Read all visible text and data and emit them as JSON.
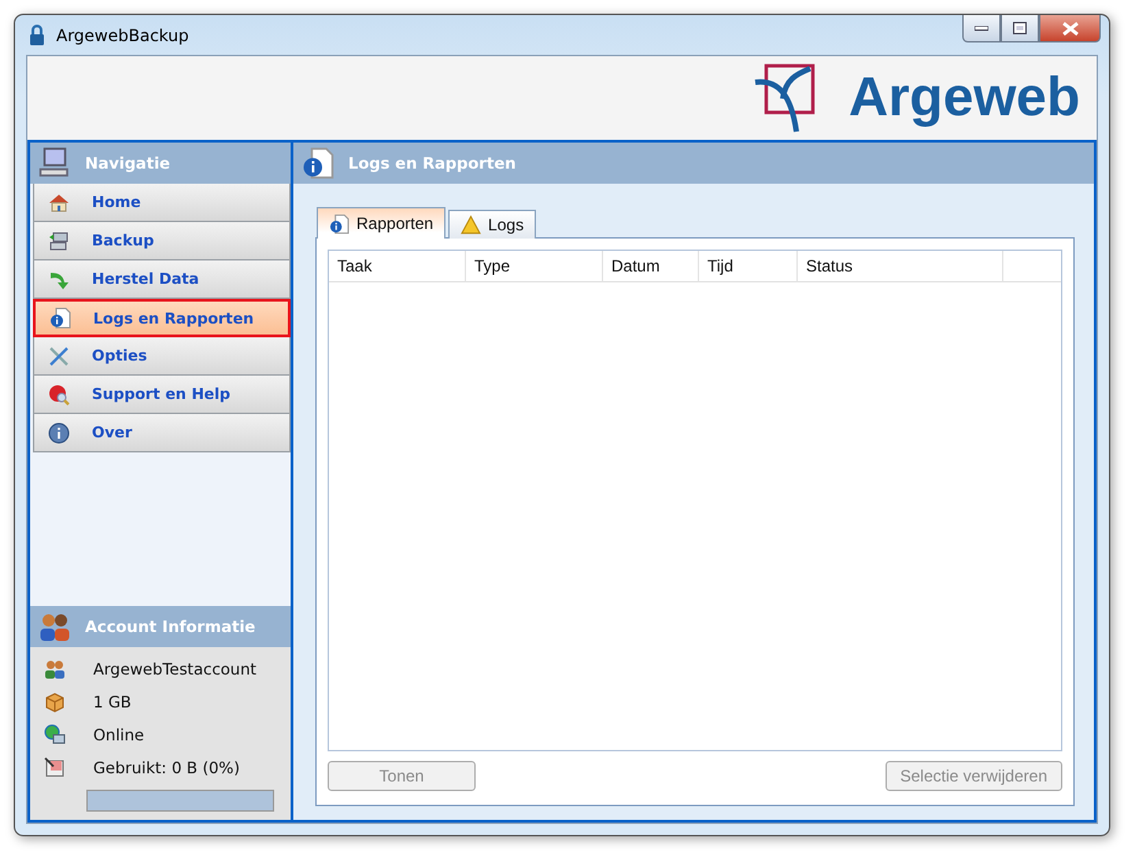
{
  "window": {
    "title": "ArgewebBackup"
  },
  "logo": {
    "text": "Argeweb"
  },
  "navigation": {
    "title": "Navigatie",
    "items": [
      {
        "label": "Home",
        "selected": false
      },
      {
        "label": "Backup",
        "selected": false
      },
      {
        "label": "Herstel Data",
        "selected": false
      },
      {
        "label": "Logs en Rapporten",
        "selected": true
      },
      {
        "label": "Opties",
        "selected": false
      },
      {
        "label": "Support en Help",
        "selected": false
      },
      {
        "label": "Over",
        "selected": false
      }
    ]
  },
  "account": {
    "title": "Account Informatie",
    "rows": [
      {
        "text": "ArgewebTestaccount"
      },
      {
        "text": "1 GB"
      },
      {
        "text": "Online"
      },
      {
        "text": "Gebruikt: 0 B (0%)"
      }
    ],
    "usage": {
      "level": 0
    }
  },
  "panel": {
    "title": "Logs en Rapporten",
    "tabs": [
      {
        "label": "Rapporten",
        "selected": true
      },
      {
        "label": "Logs",
        "selected": false
      }
    ],
    "table": {
      "columns": [
        "Taak",
        "Type",
        "Datum",
        "Tijd",
        "Status"
      ]
    },
    "buttons": [
      {
        "label": "Tonen",
        "disabled": true
      },
      {
        "label": "Selectie verwijderen",
        "disabled": true
      }
    ]
  }
}
